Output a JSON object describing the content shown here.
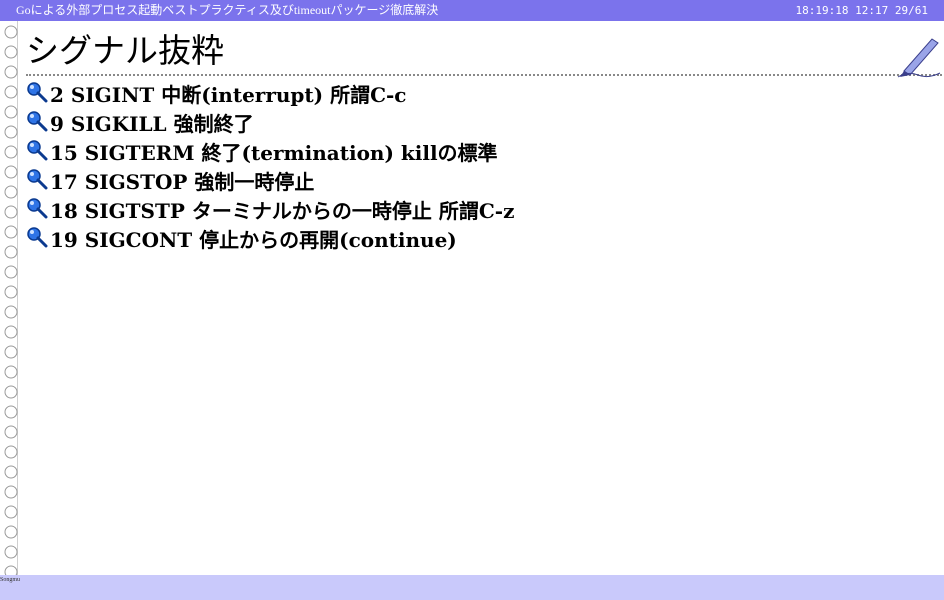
{
  "topbar": {
    "title": "Goによる外部プロセス起動ベストプラクティス及びtimeoutパッケージ徹底解決",
    "clock": "18:19:18",
    "elapsed": "12:17",
    "page": "29/61"
  },
  "slide": {
    "title": "シグナル抜粋",
    "items": [
      "2 SIGINT 中断(interrupt) 所謂C-c",
      "9 SIGKILL 強制終了",
      "15 SIGTERM 終了(termination) killの標準",
      "17 SIGSTOP 強制一時停止",
      "18 SIGTSTP ターミナルからの一時停止 所謂C-z",
      "19 SIGCONT 停止からの再開(continue)"
    ]
  },
  "footer": {
    "name": "Songmu"
  },
  "icons": {
    "bullet": "magnifier-icon",
    "rings": "binder-ring-icon",
    "pen": "fountain-pen-icon"
  },
  "colors": {
    "topbar": "#7b73ec",
    "footer": "#c9c9fb",
    "bullet": "#1f5fd6"
  }
}
